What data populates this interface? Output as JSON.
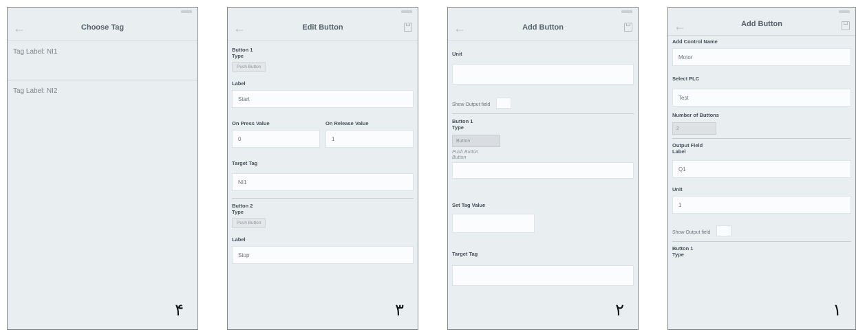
{
  "phone4": {
    "title": "Choose Tag",
    "tags": [
      "Tag Label: NI1",
      "Tag Label: NI2"
    ],
    "digit": "۴"
  },
  "phone3": {
    "title": "Edit Button",
    "button1": {
      "header": "Button 1",
      "type_label": "Type",
      "type_value": "Push Button"
    },
    "label_title": "Label",
    "label_value": "Start",
    "press_label": "On Press Value",
    "release_label": "On Release Value",
    "press_value": "0",
    "release_value": "1",
    "target_tag_label": "Target Tag",
    "target_tag_value": "NI1",
    "button2": {
      "header": "Button 2",
      "type_label": "Type",
      "type_value": "Push Button"
    },
    "label2_title": "Label",
    "label2_value": "Stop",
    "digit": "۳"
  },
  "phone2": {
    "title": "Add Button",
    "unit_label": "Unit",
    "unit_value": "",
    "show_output_label": "Show Output field",
    "button1": {
      "header": "Button 1",
      "type_label": "Type"
    },
    "type_selected": "Button",
    "type_options": [
      "Push Button",
      "Button"
    ],
    "button_field_value": "",
    "set_tag_label": "Set Tag Value",
    "target_tag_label": "Target Tag",
    "digit": "۲"
  },
  "phone1": {
    "title": "Add Button",
    "control_name_label": "Add Control Name",
    "control_name_value": "Motor",
    "select_plc_label": "Select PLC",
    "select_plc_value": "Test",
    "num_buttons_label": "Number of Buttons",
    "num_buttons_value": "2",
    "output_field_header": "Output Field",
    "label_title": "Label",
    "label_value": "Q1",
    "unit_label": "Unit",
    "unit_value": "1",
    "show_output_label": "Show Output field",
    "button1": {
      "header": "Button 1",
      "type_label": "Type"
    },
    "digit": "۱"
  },
  "icons": {
    "back": "back-arrow-icon",
    "save": "save-icon"
  },
  "colors": {
    "screen_bg": "#e9eef1",
    "field_bg": "#fbfcfd",
    "text": "#46505a"
  }
}
